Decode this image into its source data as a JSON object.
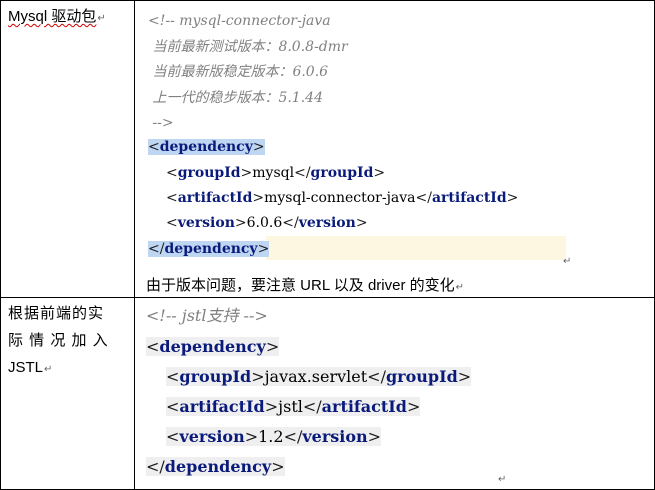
{
  "row1": {
    "label": "Mysql 驱动包",
    "code_comment": [
      "<!-- mysql-connector-java",
      " 当前最新测试版本：8.0.8-dmr",
      " 当前最新版稳定版本：6.0.6",
      " 上一代的稳步版本：5.1.44",
      " -->"
    ],
    "dependency_tag": "dependency",
    "groupId_tag": "groupId",
    "groupId_value": "mysql",
    "artifactId_tag": "artifactId",
    "artifactId_value": "mysql-connector-java",
    "version_tag": "version",
    "version_value": "6.0.6",
    "note": "由于版本问题，要注意 URL 以及 driver 的变化"
  },
  "row2": {
    "label_line1": "根据前端的实",
    "label_line2": "际 情 况 加 入",
    "label_line3": "JSTL",
    "comment": "<!-- jstl支持 -->",
    "dependency_tag": "dependency",
    "groupId_tag": "groupId",
    "groupId_value": "javax.servlet",
    "artifactId_tag": "artifactId",
    "artifactId_value": "jstl",
    "version_tag": "version",
    "version_value": "1.2"
  },
  "marks": {
    "line_end": "↵",
    "paragraph": "↵"
  }
}
